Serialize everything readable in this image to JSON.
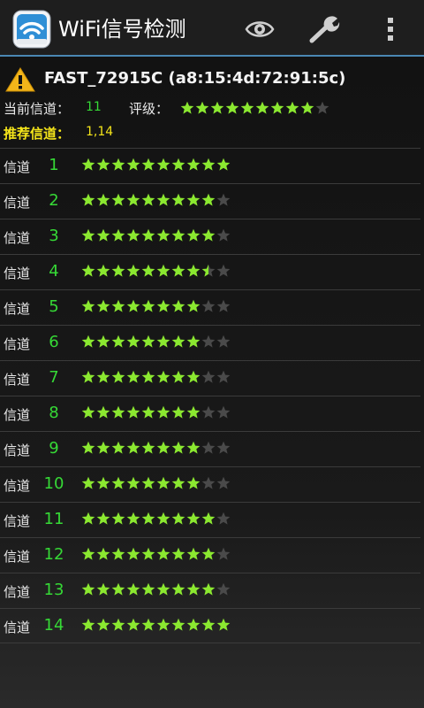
{
  "app": {
    "title": "WiFi信号检测",
    "icons": {
      "app": "wifi-app-icon",
      "eye": "eye-icon",
      "settings": "wrench-icon",
      "overflow": "overflow-menu-icon"
    }
  },
  "network": {
    "ssid_line": "FAST_72915C (a8:15:4d:72:91:5c)",
    "warning_icon": "warning-icon"
  },
  "current": {
    "label": "当前信道：",
    "channel": "11",
    "rating_label": "评级：",
    "rating": 9,
    "rating_max": 10
  },
  "recommended": {
    "label": "推荐信道：",
    "channels": "1,14"
  },
  "channel_label": "信道",
  "channels": [
    {
      "num": "1",
      "rating": 10
    },
    {
      "num": "2",
      "rating": 9
    },
    {
      "num": "3",
      "rating": 9
    },
    {
      "num": "4",
      "rating": 8.5
    },
    {
      "num": "5",
      "rating": 8
    },
    {
      "num": "6",
      "rating": 8
    },
    {
      "num": "7",
      "rating": 8
    },
    {
      "num": "8",
      "rating": 8
    },
    {
      "num": "9",
      "rating": 8
    },
    {
      "num": "10",
      "rating": 8
    },
    {
      "num": "11",
      "rating": 9
    },
    {
      "num": "12",
      "rating": 9
    },
    {
      "num": "13",
      "rating": 9
    },
    {
      "num": "14",
      "rating": 10
    }
  ],
  "colors": {
    "star_on": "#8be830",
    "star_off": "#4a4a4a",
    "accent": "#4a87b3",
    "channel_num": "#36d936",
    "recommend": "#f4e41a"
  }
}
